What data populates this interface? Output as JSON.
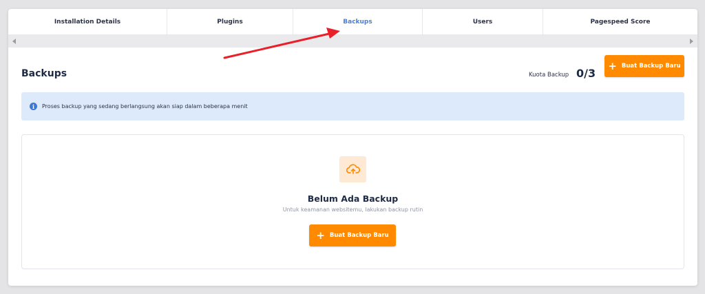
{
  "tabs": [
    {
      "label": "Installation Details",
      "active": false
    },
    {
      "label": "Plugins",
      "active": false
    },
    {
      "label": "Backups",
      "active": true
    },
    {
      "label": "Users",
      "active": false
    },
    {
      "label": "Pagespeed Score",
      "active": false
    }
  ],
  "header": {
    "title": "Backups",
    "quota_label": "Kuota Backup",
    "quota_value": "0/3",
    "new_backup_label": "Buat Backup Baru"
  },
  "alert": {
    "icon": "info-icon",
    "text": "Proses backup yang sedang berlangsung akan siap dalam beberapa menit"
  },
  "empty_state": {
    "icon": "cloud-upload-icon",
    "title": "Belum Ada Backup",
    "subtitle": "Untuk keamanan websitemu, lakukan backup rutin",
    "button_label": "Buat Backup Baru"
  },
  "colors": {
    "accent": "#ff8a00",
    "active_tab": "#4a7fd6",
    "alert_bg": "#dceafc",
    "annotation_arrow": "#e8202a"
  }
}
